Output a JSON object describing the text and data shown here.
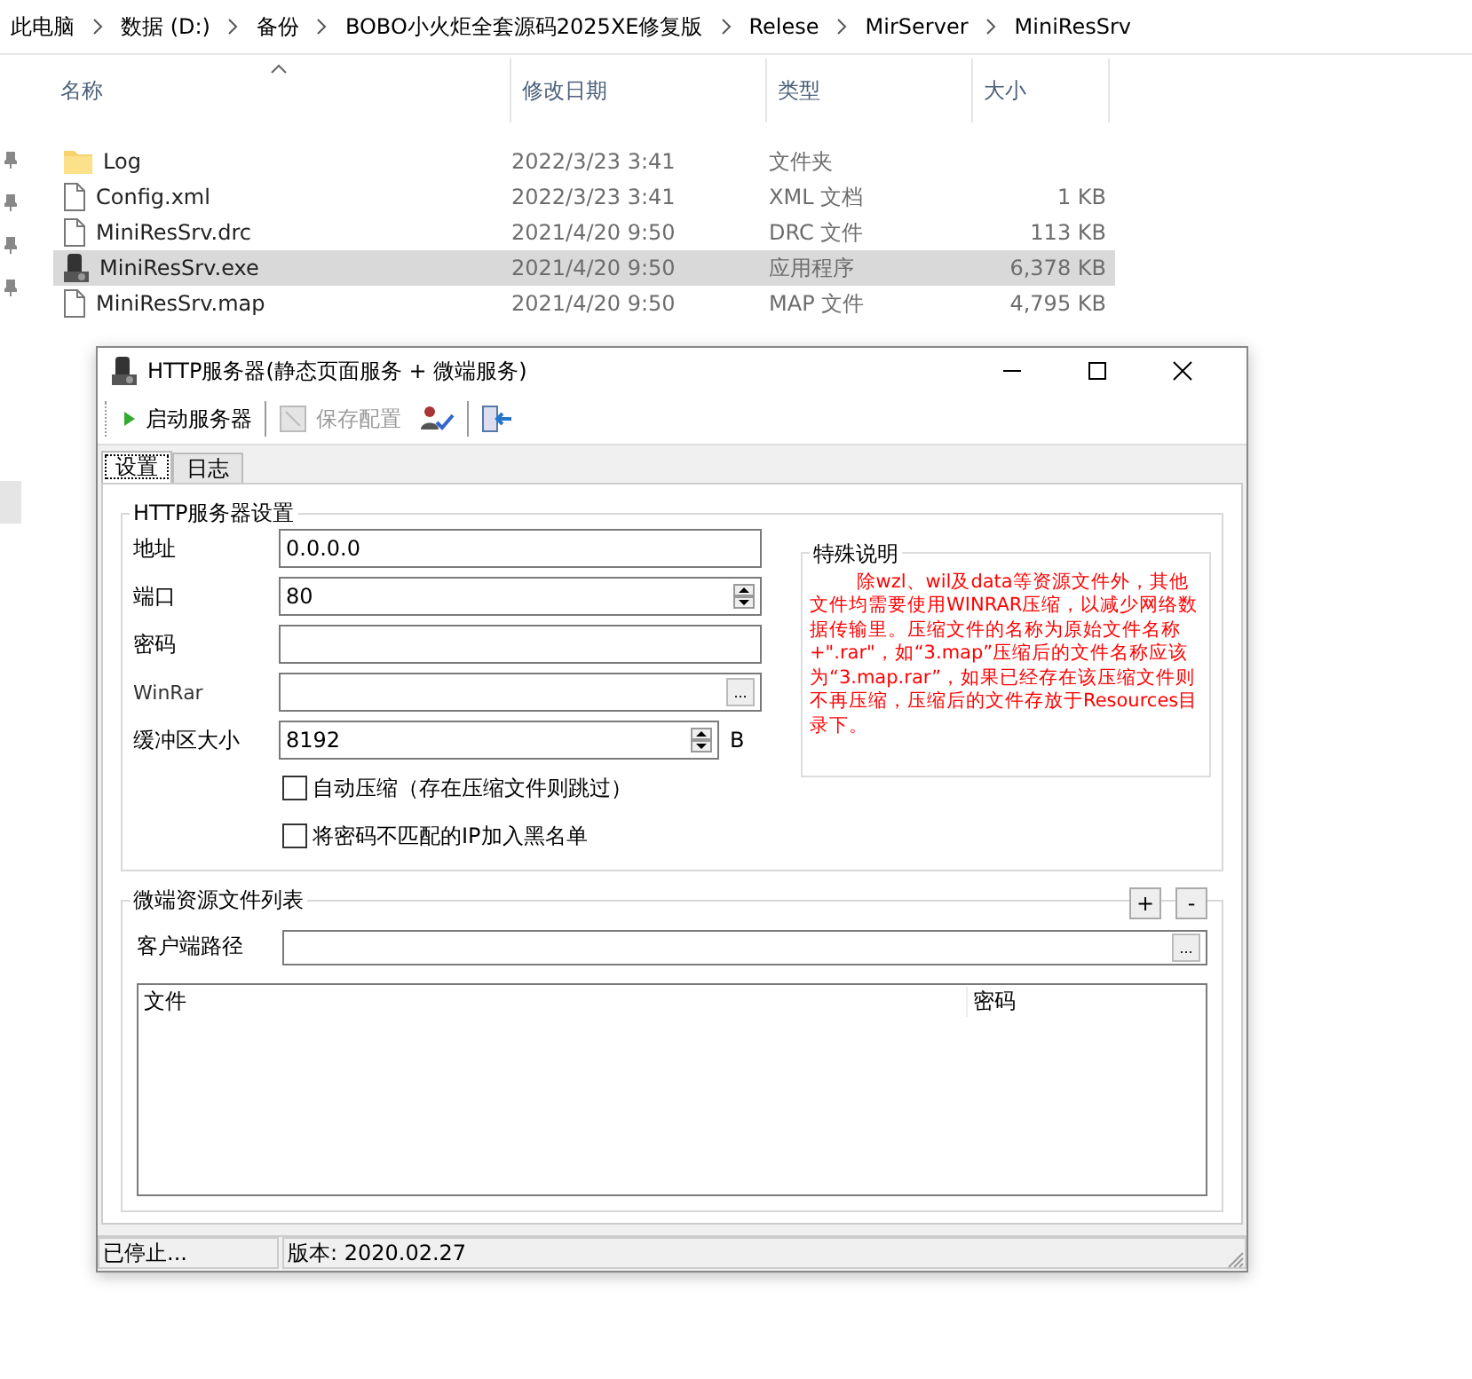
{
  "breadcrumb": [
    "此电脑",
    "数据 (D:)",
    "备份",
    "BOBO小火炬全套源码2025XE修复版",
    "Relese",
    "MirServer",
    "MiniResSrv"
  ],
  "file_list": {
    "columns": [
      "名称",
      "修改日期",
      "类型",
      "大小"
    ],
    "rows": [
      {
        "kind": "folder",
        "name": "Log",
        "modified": "2022/3/23 3:41",
        "type": "文件夹",
        "selected": false
      },
      {
        "kind": "file",
        "name": "Config.xml",
        "modified": "2022/3/23 3:41",
        "type": "XML 文档",
        "size": "1 KB",
        "selected": false
      },
      {
        "kind": "file",
        "name": "MiniResSrv.drc",
        "modified": "2021/4/20 9:50",
        "type": "DRC 文件",
        "size": "113 KB",
        "selected": false
      },
      {
        "kind": "app",
        "name": "MiniResSrv.exe",
        "modified": "2021/4/20 9:50",
        "type": "应用程序",
        "size": "6,378 KB",
        "selected": true
      },
      {
        "kind": "file",
        "name": "MiniResSrv.map",
        "modified": "2021/4/20 9:50",
        "type": "MAP 文件",
        "size": "4,795 KB",
        "selected": false
      }
    ]
  },
  "dialog": {
    "title": "HTTP服务器(静态页面服务 + 微端服务)",
    "toolbar": [
      {
        "kind": "play",
        "label": "启动服务器",
        "disabled": false,
        "separator_after": true
      },
      {
        "kind": "save",
        "label": "保存配置",
        "disabled": true,
        "separator_after": false
      },
      {
        "kind": "user-check",
        "disabled": false,
        "separator_after": true
      },
      {
        "kind": "exit",
        "disabled": false,
        "separator_after": false
      }
    ],
    "tabs": [
      {
        "label": "设置",
        "selected": true
      },
      {
        "label": "日志",
        "selected": false
      }
    ],
    "server_settings": {
      "title": "HTTP服务器设置",
      "fields": [
        {
          "kind": "text",
          "label": "地址",
          "value": "0.0.0.0"
        },
        {
          "kind": "spin",
          "label": "端口",
          "value": "80"
        },
        {
          "kind": "text",
          "label": "密码"
        },
        {
          "kind": "browse",
          "label": "WinRar",
          "button": "..."
        },
        {
          "kind": "spin",
          "label": "缓冲区大小",
          "value": "8192",
          "unit": "B"
        }
      ],
      "checkboxes": [
        {
          "label": "自动压缩（存在压缩文件则跳过）",
          "checked": false
        },
        {
          "label": "将密码不匹配的IP加入黑名单",
          "checked": false
        }
      ],
      "note": {
        "title": "特殊说明",
        "text": "除wzl、wil及data等资源文件外，其他文件均需要使用WINRAR压缩，以减少网络数据传输里。压缩文件的名称为原始文件名称+\".rar\"，如“3.map”压缩后的文件名称应该为“3.map.rar”，如果已经存在该压缩文件则不再压缩，压缩后的文件存放于Resources目录下。"
      }
    },
    "resources": {
      "title": "微端资源文件列表",
      "add_button": "+",
      "remove_button": "-",
      "path_label": "客户端路径",
      "browse_button": "...",
      "columns": [
        "文件",
        "密码"
      ]
    },
    "status_bar": [
      "已停止...",
      "版本: 2020.02.27"
    ]
  }
}
